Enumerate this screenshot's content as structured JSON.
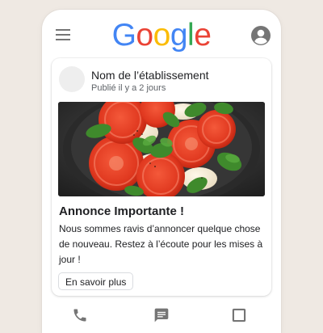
{
  "header": {
    "logo_letters": [
      "G",
      "o",
      "o",
      "g",
      "l",
      "e"
    ],
    "logo_colors": [
      "#4285F4",
      "#EA4335",
      "#FBBC05",
      "#4285F4",
      "#34A853",
      "#EA4335"
    ],
    "menu_icon": "hamburger-menu-icon",
    "account_icon": "account-circle-icon"
  },
  "post": {
    "business_name": "Nom de l’établissement",
    "posted_time": "Publié il y a 2 jours",
    "image": "tomato-mozzarella-basil-salad-photo",
    "title": "Annonce Importante !",
    "body": "Nous sommes ravis d’annoncer quelque chose de nouveau. Restez à l’écoute pour les mises à jour !",
    "cta_label": "En savoir plus"
  },
  "bottom_nav": {
    "items": [
      "phone-icon",
      "message-icon",
      "square-icon"
    ]
  },
  "colors": {
    "icon_gray": "#757575",
    "background": "#efe9e3"
  }
}
